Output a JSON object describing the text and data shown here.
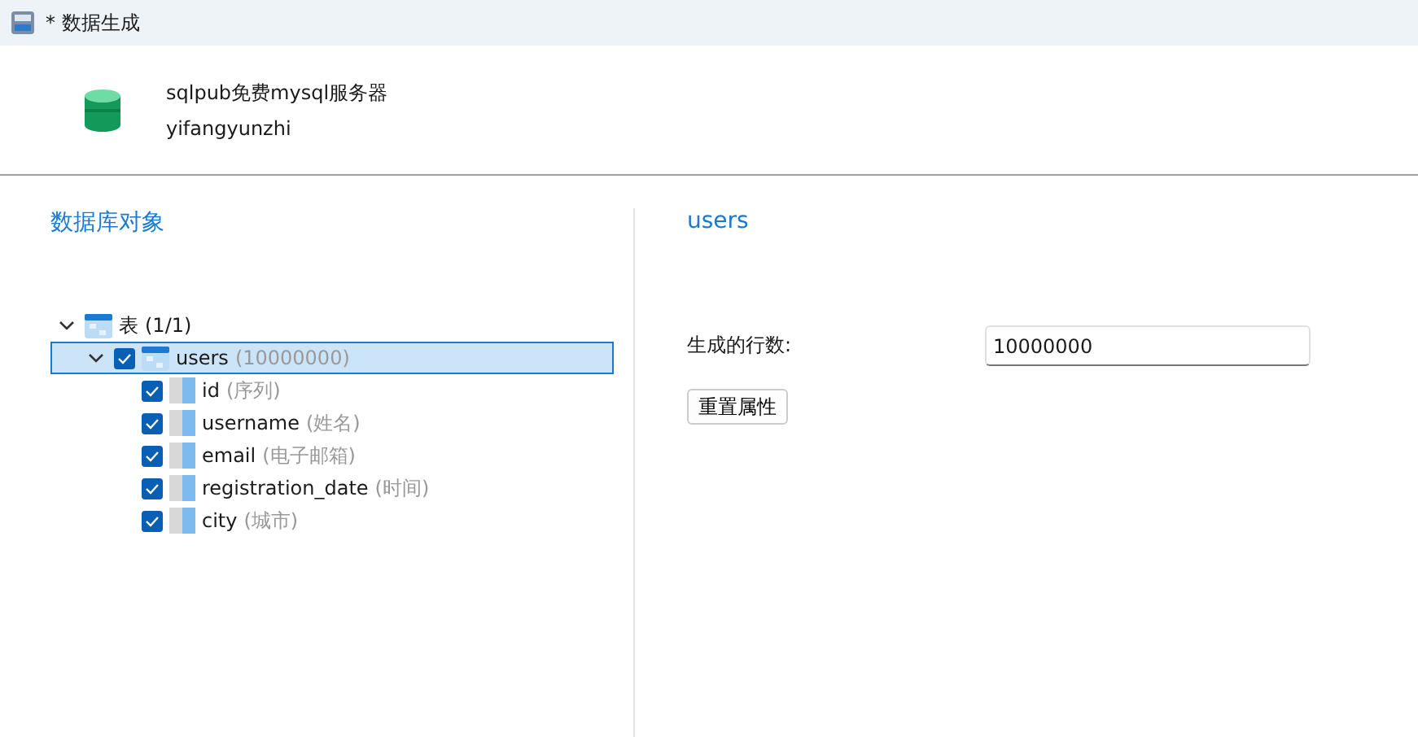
{
  "window": {
    "title": "* 数据生成"
  },
  "connection": {
    "name": "sqlpub免费mysql服务器",
    "database": "yifangyunzhi"
  },
  "left_panel": {
    "heading": "数据库对象"
  },
  "tree": [
    {
      "label": "表",
      "count": "(1/1)",
      "expanded": true,
      "children": [
        {
          "label": "users",
          "count": "(10000000)",
          "expanded": true,
          "checked": true,
          "selected": true,
          "children": [
            {
              "label": "id",
              "note": "(序列)",
              "checked": true
            },
            {
              "label": "username",
              "note": "(姓名)",
              "checked": true
            },
            {
              "label": "email",
              "note": "(电子邮箱)",
              "checked": true
            },
            {
              "label": "registration_date",
              "note": "(时间)",
              "checked": true
            },
            {
              "label": "city",
              "note": "(城市)",
              "checked": true
            }
          ]
        }
      ]
    }
  ],
  "right_panel": {
    "heading": "users",
    "rows_label": "生成的行数:",
    "rows_value": "10000000",
    "reset_button": "重置属性"
  }
}
